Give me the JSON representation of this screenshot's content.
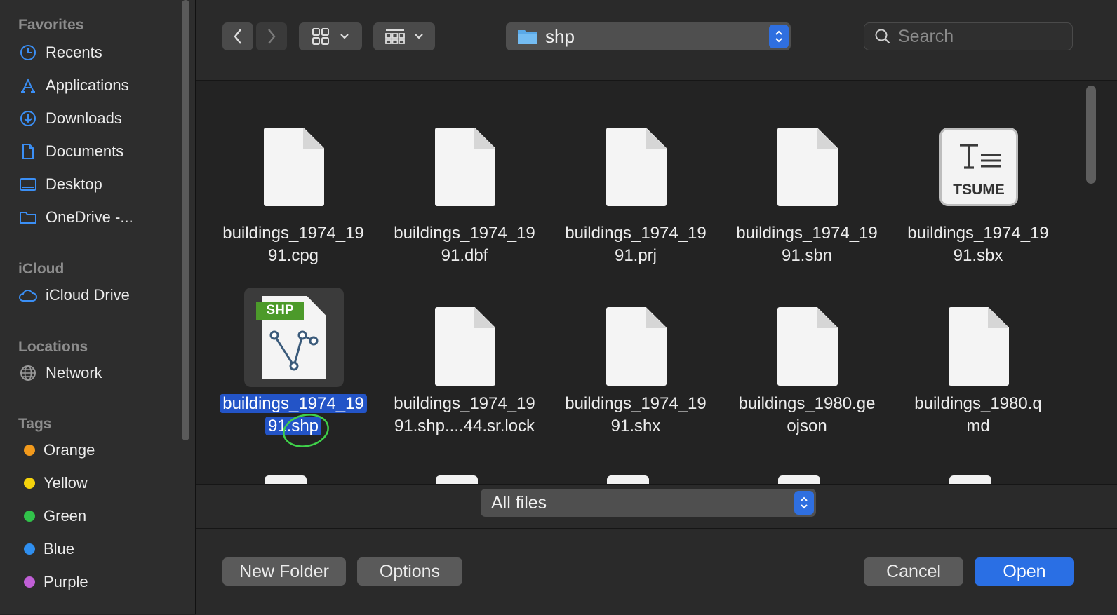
{
  "sidebar": {
    "favorites_title": "Favorites",
    "favorites": [
      {
        "label": "Recents",
        "icon": "clock-icon"
      },
      {
        "label": "Applications",
        "icon": "applications-icon"
      },
      {
        "label": "Downloads",
        "icon": "download-icon"
      },
      {
        "label": "Documents",
        "icon": "document-icon"
      },
      {
        "label": "Desktop",
        "icon": "desktop-icon"
      },
      {
        "label": "OneDrive -...",
        "icon": "folder-icon"
      }
    ],
    "icloud_title": "iCloud",
    "icloud": [
      {
        "label": "iCloud Drive",
        "icon": "cloud-icon"
      }
    ],
    "locations_title": "Locations",
    "locations": [
      {
        "label": "Network",
        "icon": "globe-icon"
      }
    ],
    "tags_title": "Tags",
    "tags": [
      {
        "label": "Orange",
        "color": "#f29a1c"
      },
      {
        "label": "Yellow",
        "color": "#f5d30c"
      },
      {
        "label": "Green",
        "color": "#31c24a"
      },
      {
        "label": "Blue",
        "color": "#2f8ff0"
      },
      {
        "label": "Purple",
        "color": "#c05fd6"
      }
    ]
  },
  "toolbar": {
    "folder": "shp",
    "search_placeholder": "Search"
  },
  "files": [
    {
      "line1": "buildings_1974_19",
      "line2": "91.cpg",
      "icon": "blank"
    },
    {
      "line1": "buildings_1974_19",
      "line2": "91.dbf",
      "icon": "blank"
    },
    {
      "line1": "buildings_1974_19",
      "line2": "91.prj",
      "icon": "blank"
    },
    {
      "line1": "buildings_1974_19",
      "line2": "91.sbn",
      "icon": "blank"
    },
    {
      "line1": "buildings_1974_19",
      "line2": "91.sbx",
      "icon": "tsume",
      "icon_text": "TSUME"
    },
    {
      "line1": "buildings_1974_19",
      "line2": "91.shp",
      "icon": "shp",
      "icon_text": "SHP",
      "selected": true
    },
    {
      "line1": "buildings_1974_19",
      "line2": "91.shp....44.sr.lock",
      "icon": "blank"
    },
    {
      "line1": "buildings_1974_19",
      "line2": "91.shx",
      "icon": "blank"
    },
    {
      "line1": "buildings_1980.ge",
      "line2": "ojson",
      "icon": "blank"
    },
    {
      "line1": "buildings_1980.q",
      "line2": "md",
      "icon": "blank"
    }
  ],
  "footer": {
    "filter": "All files",
    "new_folder": "New Folder",
    "options": "Options",
    "cancel": "Cancel",
    "open": "Open"
  },
  "colors": {
    "accent": "#2a6fe4",
    "selection": "#2354c7",
    "annotation": "#3fd14a"
  }
}
